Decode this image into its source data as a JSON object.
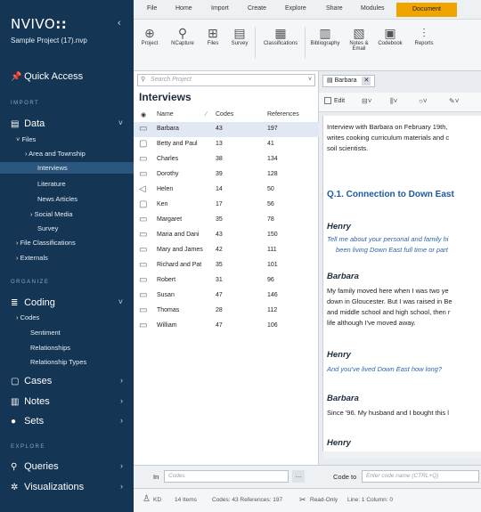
{
  "app": {
    "logo": "NVIVO",
    "logo_mark": "::",
    "project": "Sample Project (17).nvp",
    "collapse": "‹"
  },
  "sidebar": {
    "quick_access": "Quick Access",
    "sec_import": "IMPORT",
    "data": "Data",
    "files": "Files",
    "area_township": "Area and Township",
    "interviews": "Interviews",
    "literature": "Literature",
    "news_articles": "News Articles",
    "social_media": "Social Media",
    "survey": "Survey",
    "file_classifications": "File Classifications",
    "externals": "Externals",
    "sec_organize": "ORGANIZE",
    "coding": "Coding",
    "codes": "Codes",
    "sentiment": "Sentiment",
    "relationships": "Relationships",
    "relationship_types": "Relationship Types",
    "cases": "Cases",
    "notes": "Notes",
    "sets": "Sets",
    "sec_explore": "EXPLORE",
    "queries": "Queries",
    "visualizations": "Visualizations"
  },
  "ribbon": {
    "tabs": [
      "File",
      "Home",
      "Import",
      "Create",
      "Explore",
      "Share",
      "Modules"
    ],
    "document_tab": "Document",
    "buttons": [
      "Project",
      "NCapture",
      "Files",
      "Survey",
      "Classifications",
      "Bibliography",
      "Notes &",
      "Email",
      "Codebook",
      "Reports"
    ]
  },
  "list": {
    "search_placeholder": "Search Project",
    "title": "Interviews",
    "col_name": "Name",
    "col_codes": "Codes",
    "col_refs": "References",
    "rows": [
      {
        "name": "Barbara",
        "codes": "43",
        "refs": "197"
      },
      {
        "name": "Betty and Paul",
        "codes": "13",
        "refs": "41"
      },
      {
        "name": "Charles",
        "codes": "38",
        "refs": "134"
      },
      {
        "name": "Dorothy",
        "codes": "39",
        "refs": "128"
      },
      {
        "name": "Helen",
        "codes": "14",
        "refs": "50"
      },
      {
        "name": "Ken",
        "codes": "17",
        "refs": "56"
      },
      {
        "name": "Margaret",
        "codes": "35",
        "refs": "78"
      },
      {
        "name": "Maria and Dani",
        "codes": "43",
        "refs": "150"
      },
      {
        "name": "Mary and James",
        "codes": "42",
        "refs": "111"
      },
      {
        "name": "Richard and Pat",
        "codes": "35",
        "refs": "101"
      },
      {
        "name": "Robert",
        "codes": "31",
        "refs": "96"
      },
      {
        "name": "Susan",
        "codes": "47",
        "refs": "146"
      },
      {
        "name": "Thomas",
        "codes": "28",
        "refs": "112"
      },
      {
        "name": "William",
        "codes": "47",
        "refs": "106"
      }
    ]
  },
  "doc": {
    "tab_label": "Barbara",
    "edit": "Edit",
    "l1": "Interview with Barbara on February 19th,",
    "l2": "writes cooking curriculum materials and c",
    "l3": "soil scientists.",
    "heading": "Q.1. Connection to Down East",
    "henry1": "Henry",
    "q1a": "Tell me about your personal and family hi",
    "q1b": "been living Down East full time or part",
    "barbara1": "Barbara",
    "a1a": "My family moved here when I was two ye",
    "a1b": "down in Gloucester. But I was raised in Be",
    "a1c": "and middle school and high school, then r",
    "a1d": "life although I've moved away.",
    "henry2": "Henry",
    "q2": "And you've lived Down East how long?",
    "barbara2": "Barbara",
    "a2": "Since '96. My husband and I bought this l",
    "henry3": "Henry"
  },
  "codebar": {
    "in_label": "In",
    "in_placeholder": "Codes",
    "more": "...",
    "code_to_label": "Code to",
    "code_to_placeholder": "Enter code name (CTRL+Q)"
  },
  "status": {
    "user": "KD",
    "items": "14 Items",
    "codes_refs": "Codes: 43  References: 197",
    "readonly": "Read-Only",
    "line": "Line: 1  Column: 0"
  }
}
